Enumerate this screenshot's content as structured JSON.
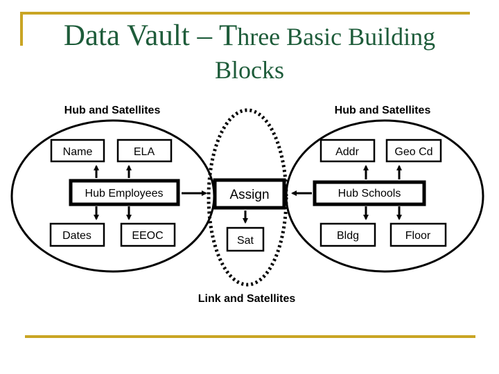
{
  "title": {
    "line1_main": "Data Vault – T",
    "line1_rest": "hree Basic Building",
    "line2": "Blocks"
  },
  "colors": {
    "accent_gold": "#c9a524",
    "title_green": "#1e5c3a",
    "diagram_stroke": "#000000"
  },
  "diagram": {
    "left_group": {
      "label": "Hub and Satellites",
      "hub": "Hub Employees",
      "satellites_top": [
        "Name",
        "ELA"
      ],
      "satellites_bottom": [
        "Dates",
        "EEOC"
      ]
    },
    "right_group": {
      "label": "Hub and Satellites",
      "hub": "Hub Schools",
      "satellites_top": [
        "Addr",
        "Geo Cd"
      ],
      "satellites_bottom": [
        "Bldg",
        "Floor"
      ]
    },
    "link_group": {
      "label": "Link and Satellites",
      "link": "Assign",
      "satellite": "Sat"
    }
  }
}
